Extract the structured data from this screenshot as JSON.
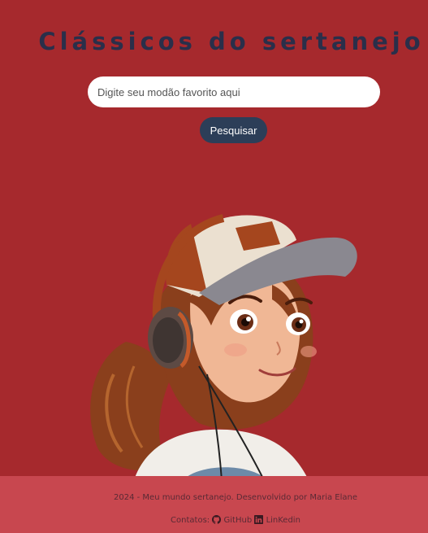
{
  "header": {
    "title": "Clássicos do sertanejo"
  },
  "search": {
    "placeholder": "Digite seu modão favorito aqui",
    "value": "",
    "button_label": "Pesquisar"
  },
  "illustration": {
    "icon": "girl-with-headphones-illustration"
  },
  "footer": {
    "text": "2024 - Meu mundo sertanejo. Desenvolvido por Maria Elane",
    "contacts_label": "Contatos:",
    "links": [
      {
        "label": "GitHub",
        "icon": "github-icon"
      },
      {
        "label": "LinKedin",
        "icon": "linkedin-icon"
      }
    ]
  },
  "colors": {
    "background": "#a6292d",
    "footer": "#c8474f",
    "title": "#2a2f4a",
    "button": "#2c3e58"
  }
}
